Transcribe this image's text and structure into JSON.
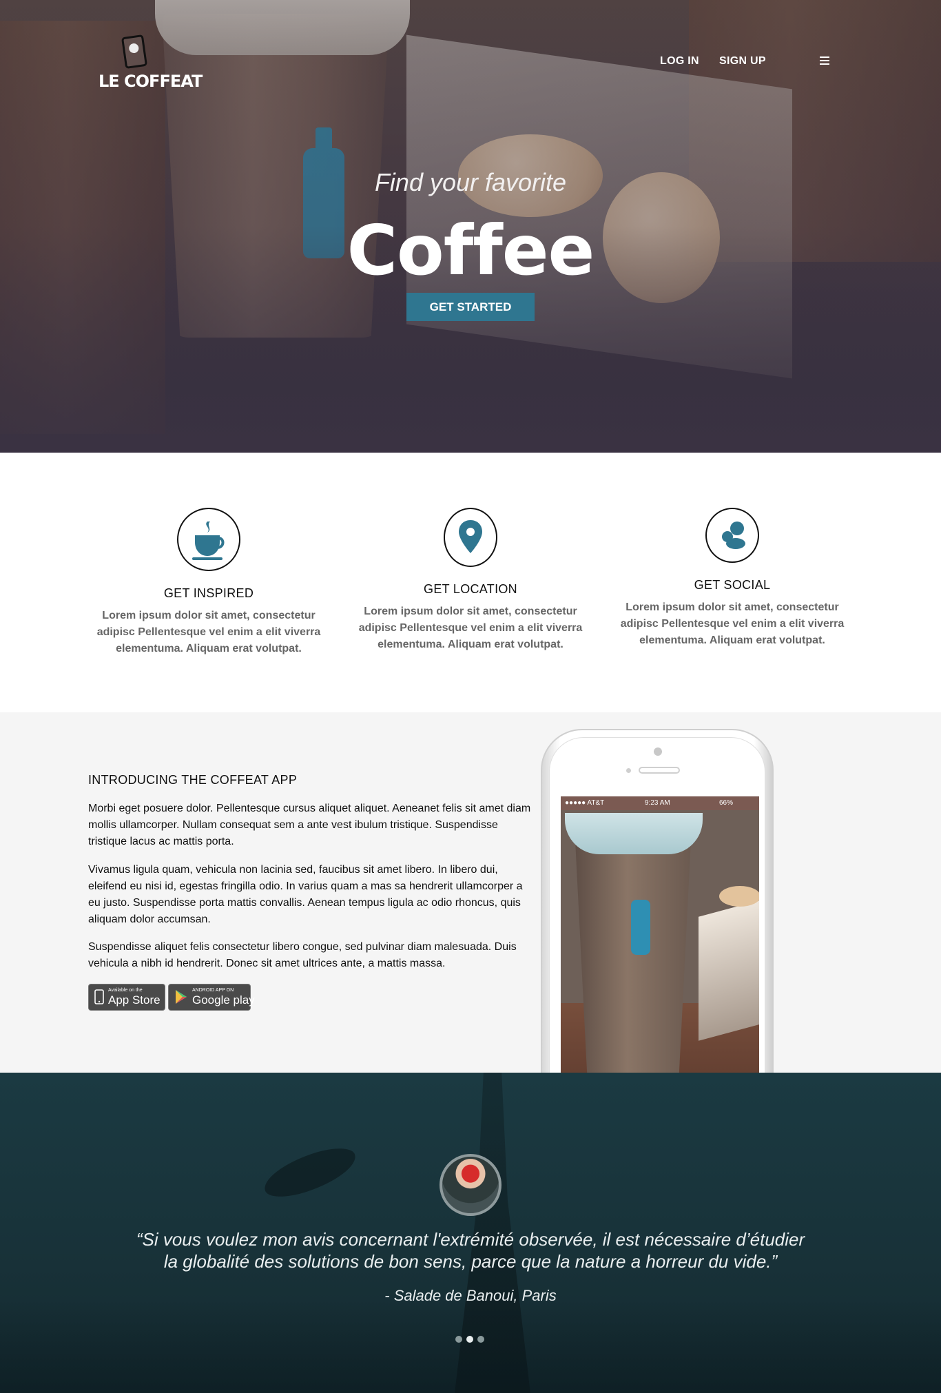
{
  "header": {
    "logo_text": "LE COFFEAT",
    "nav": {
      "login": "LOG IN",
      "signup": "SIGN UP"
    },
    "menu_icon": "hamburger-icon"
  },
  "hero": {
    "subtitle": "Find your favorite",
    "title": "Coffee",
    "cta": "GET STARTED"
  },
  "features": [
    {
      "icon": "coffee-cup-icon",
      "title": "GET INSPIRED",
      "text": "Lorem ipsum dolor sit amet, consectetur adipisc Pellentesque vel enim a elit viverra elementuma. Aliquam erat volutpat."
    },
    {
      "icon": "location-pin-icon",
      "title": "GET LOCATION",
      "text": "Lorem ipsum dolor sit amet, consectetur adipisc Pellentesque vel enim a elit viverra elementuma. Aliquam erat volutpat."
    },
    {
      "icon": "social-people-icon",
      "title": "GET SOCIAL",
      "text": "Lorem ipsum dolor sit amet, consectetur adipisc Pellentesque vel enim a elit viverra elementuma. Aliquam erat volutpat."
    }
  ],
  "app": {
    "heading": "INTRODUCING THE COFFEAT APP",
    "paragraphs": [
      "Morbi eget posuere dolor. Pellentesque cursus aliquet aliquet. Aeneanet felis sit amet diam mollis ullamcorper. Nullam consequat sem a ante vest ibulum tristique. Suspendisse tristique lacus ac mattis porta.",
      "Vivamus ligula quam, vehicula non lacinia sed, faucibus sit amet libero. In libero dui, eleifend eu nisi id, egestas fringilla odio. In varius quam a mas sa hendrerit ullamcorper a eu justo. Suspendisse porta mattis convallis. Aenean tempus ligula ac odio rhoncus, quis aliquam dolor accumsan.",
      "Suspendisse aliquet felis consectetur libero congue, sed pulvinar diam malesuada. Duis vehicula a nibh id hendrerit. Donec sit amet ultrices ante, a mattis massa."
    ],
    "store_apple": {
      "small": "Available on the",
      "big": "App Store"
    },
    "store_google": {
      "small": "ANDROID APP ON",
      "big": "Google play"
    },
    "phone_status": {
      "carrier": "●●●●● AT&T",
      "time": "9:23 AM",
      "battery": "66%"
    }
  },
  "testimonial": {
    "quote": "“Si vous voulez mon avis concernant l'extrémité observée, il est nécessaire d’étudier la globalité des solutions de bon sens, parce que la nature a horreur du vide.”",
    "author": "- Salade de Banoui, Paris",
    "slides": 3,
    "active_slide": 2
  },
  "colors": {
    "accent": "#2f7690",
    "hero_overlay": "#3a3140",
    "testimonial_bg": "#183239",
    "section_gray": "#f5f5f5"
  }
}
